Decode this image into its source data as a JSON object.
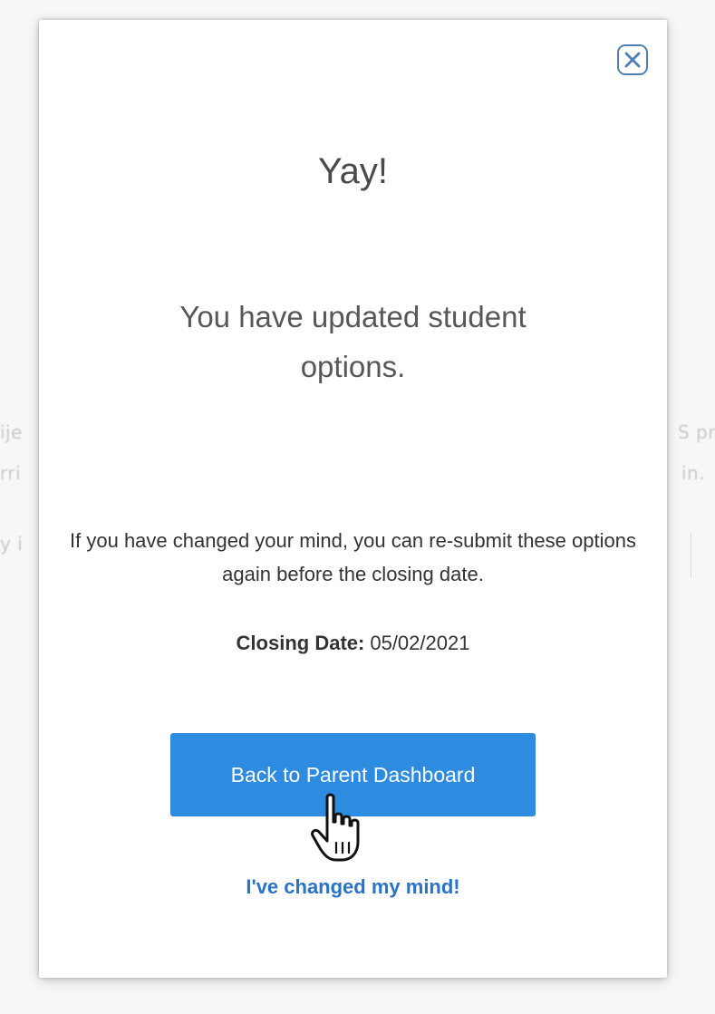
{
  "background": {
    "left_fragments": [
      "ije",
      "rri",
      "y i"
    ],
    "right_fragments": [
      "S pro",
      "in."
    ]
  },
  "modal": {
    "title": "Yay!",
    "message": "You have updated student options.",
    "note": "If you have changed your mind, you can re-submit these options again before the closing date.",
    "closing_label": "Closing Date:",
    "closing_value": "05/02/2021",
    "primary_button_label": "Back to Parent Dashboard",
    "secondary_link_label": "I've changed my mind!"
  },
  "icons": {
    "close": "close-icon",
    "cursor": "hand-pointer-icon"
  },
  "colors": {
    "primary_button": "#2d8be0",
    "link": "#2a73c6",
    "close_icon": "#4d7fb3"
  }
}
